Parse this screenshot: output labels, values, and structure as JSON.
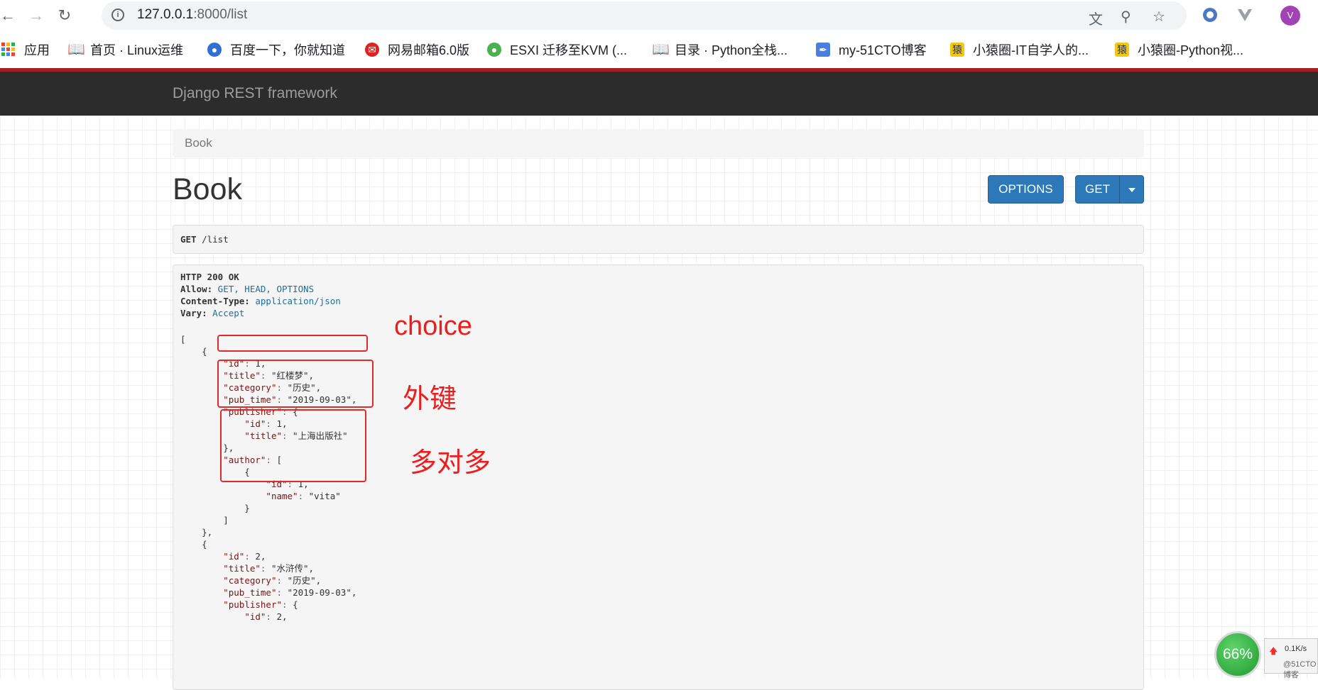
{
  "browser": {
    "url_host": "127.0.0.1",
    "url_rest": ":8000/list",
    "avatar_letter": "V",
    "bookmarks": [
      {
        "label": "应用",
        "icon": "apps-grid-icon"
      },
      {
        "label": "首页 · Linux运维",
        "icon": "book-icon"
      },
      {
        "label": "百度一下，你就知道",
        "icon": "baidu-paw-icon"
      },
      {
        "label": "网易邮箱6.0版",
        "icon": "netease-mail-icon"
      },
      {
        "label": "ESXI 迁移至KVM (...",
        "icon": "frog-icon"
      },
      {
        "label": "目录 · Python全栈...",
        "icon": "book-icon"
      },
      {
        "label": "my-51CTO博客",
        "icon": "feather-icon"
      },
      {
        "label": "小猿圈-IT自学人的...",
        "icon": "yuan-icon"
      },
      {
        "label": "小猿圈-Python视...",
        "icon": "yuan-icon"
      }
    ]
  },
  "drf": {
    "brand": "Django REST framework",
    "breadcrumb": "Book",
    "title": "Book",
    "options_label": "OPTIONS",
    "get_label": "GET",
    "request_method": "GET",
    "request_path": " /list"
  },
  "response": {
    "status_line": "HTTP 200 OK",
    "headers": [
      {
        "name": "Allow:",
        "value": " GET, HEAD, OPTIONS"
      },
      {
        "name": "Content-Type:",
        "value": " application/json"
      },
      {
        "name": "Vary:",
        "value": " Accept"
      }
    ]
  },
  "annotations": {
    "choice": "choice",
    "foreign_key": "外键",
    "many_to_many": "多对多"
  },
  "speed_widget": {
    "percent": "66%",
    "upload": "0.1K/s",
    "watermark": "@51CTO博客"
  }
}
